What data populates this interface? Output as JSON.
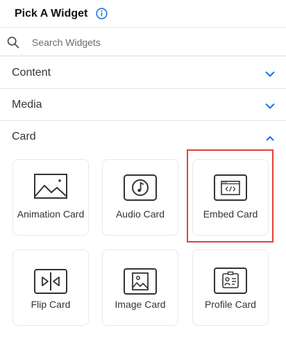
{
  "header": {
    "title": "Pick A Widget",
    "info_icon": "info-icon"
  },
  "search": {
    "placeholder": "Search Widgets",
    "icon": "search-icon"
  },
  "sections": {
    "content": {
      "label": "Content",
      "state": "collapsed"
    },
    "media": {
      "label": "Media",
      "state": "collapsed"
    },
    "card": {
      "label": "Card",
      "state": "expanded"
    }
  },
  "cards": [
    {
      "label": "Animation Card",
      "icon": "image-landscape-icon"
    },
    {
      "label": "Audio Card",
      "icon": "music-note-icon"
    },
    {
      "label": "Embed Card",
      "icon": "code-window-icon",
      "selected": true
    },
    {
      "label": "Flip Card",
      "icon": "flip-icon"
    },
    {
      "label": "Image Card",
      "icon": "image-icon"
    },
    {
      "label": "Profile Card",
      "icon": "id-card-icon"
    }
  ],
  "colors": {
    "accent": "#1a73e8",
    "selection": "#e0413a",
    "icon_stroke": "#333333"
  }
}
